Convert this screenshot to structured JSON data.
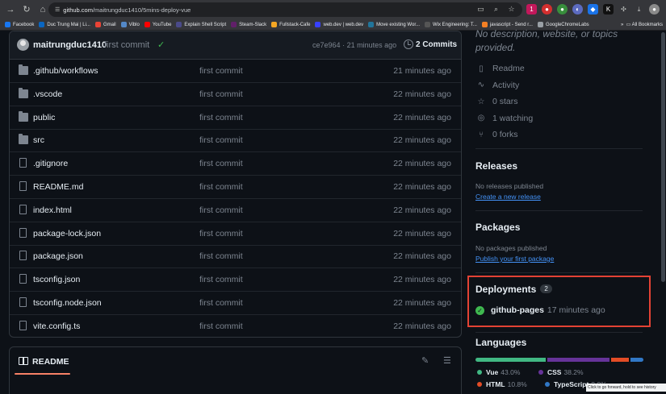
{
  "browser": {
    "url_host": "github.com",
    "url_path": "/maitrungduc1410/5mins-deploy-vue",
    "bookmarks": [
      {
        "label": "Facebook",
        "color": "#1877f2"
      },
      {
        "label": "Duc Trung Mai | Li...",
        "color": "#0a66c2"
      },
      {
        "label": "Gmail",
        "color": "#ea4335"
      },
      {
        "label": "Viblo",
        "color": "#5488c7"
      },
      {
        "label": "YouTube",
        "color": "#ff0000"
      },
      {
        "label": "Explain Shell Script",
        "color": "#4a4a8a"
      },
      {
        "label": "Steam-Slack",
        "color": "#611f69"
      },
      {
        "label": "Fullstack-Cafe",
        "color": "#f5a623"
      },
      {
        "label": "web.dev | web.dev",
        "color": "#3740ff"
      },
      {
        "label": "Move existing Wor...",
        "color": "#21759b"
      },
      {
        "label": "Wix Engineering: T...",
        "color": "#555555"
      },
      {
        "label": "javascript - Send r...",
        "color": "#f48024"
      },
      {
        "label": "GoogleChromeLabs",
        "color": "#9aa0a6"
      }
    ],
    "bookmarks_overflow": "»",
    "all_bookmarks": "All Bookmarks"
  },
  "commit_bar": {
    "user": "maitrungduc1410",
    "message": "first commit",
    "hash": "ce7e964",
    "separator": "·",
    "age": "21 minutes ago",
    "commits_label": "2 Commits"
  },
  "files": [
    {
      "name": ".github/workflows",
      "type": "folder",
      "message": "first commit",
      "age": "21 minutes ago"
    },
    {
      "name": ".vscode",
      "type": "folder",
      "message": "first commit",
      "age": "22 minutes ago"
    },
    {
      "name": "public",
      "type": "folder",
      "message": "first commit",
      "age": "22 minutes ago"
    },
    {
      "name": "src",
      "type": "folder",
      "message": "first commit",
      "age": "22 minutes ago"
    },
    {
      "name": ".gitignore",
      "type": "file",
      "message": "first commit",
      "age": "22 minutes ago"
    },
    {
      "name": "README.md",
      "type": "file",
      "message": "first commit",
      "age": "22 minutes ago"
    },
    {
      "name": "index.html",
      "type": "file",
      "message": "first commit",
      "age": "22 minutes ago"
    },
    {
      "name": "package-lock.json",
      "type": "file",
      "message": "first commit",
      "age": "22 minutes ago"
    },
    {
      "name": "package.json",
      "type": "file",
      "message": "first commit",
      "age": "22 minutes ago"
    },
    {
      "name": "tsconfig.json",
      "type": "file",
      "message": "first commit",
      "age": "22 minutes ago"
    },
    {
      "name": "tsconfig.node.json",
      "type": "file",
      "message": "first commit",
      "age": "22 minutes ago"
    },
    {
      "name": "vite.config.ts",
      "type": "file",
      "message": "first commit",
      "age": "22 minutes ago"
    }
  ],
  "readme": {
    "title": "README"
  },
  "sidebar": {
    "about_cut": "No description, website, or topics provided.",
    "links": [
      {
        "label": "Readme",
        "icon": "book-icon"
      },
      {
        "label": "Activity",
        "icon": "pulse-icon"
      },
      {
        "label": "0 stars",
        "icon": "star-icon"
      },
      {
        "label": "1 watching",
        "icon": "eye-icon"
      },
      {
        "label": "0 forks",
        "icon": "fork-icon"
      }
    ],
    "releases": {
      "heading": "Releases",
      "text": "No releases published",
      "link": "Create a new release"
    },
    "packages": {
      "heading": "Packages",
      "text": "No packages published",
      "link": "Publish your first package"
    },
    "deployments": {
      "heading": "Deployments",
      "count": "2",
      "env": "github-pages",
      "age": "17 minutes ago"
    },
    "languages": {
      "heading": "Languages",
      "items": [
        {
          "name": "Vue",
          "percent": "43.0%",
          "share": 43.0,
          "color": "#41b883"
        },
        {
          "name": "CSS",
          "percent": "38.2%",
          "share": 38.2,
          "color": "#663399"
        },
        {
          "name": "HTML",
          "percent": "10.8%",
          "share": 10.8,
          "color": "#e34c26"
        },
        {
          "name": "TypeScript",
          "percent": "8.0%",
          "share": 8.0,
          "color": "#3178c6"
        }
      ]
    }
  },
  "tooltip": "Click to go forward, hold to see history"
}
